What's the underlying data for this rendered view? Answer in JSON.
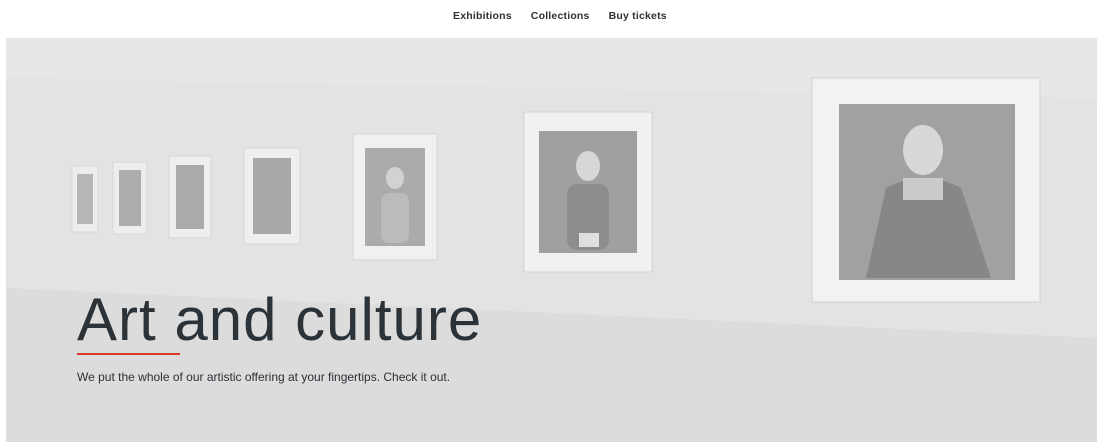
{
  "nav": {
    "items": [
      {
        "label": "Exhibitions"
      },
      {
        "label": "Collections"
      },
      {
        "label": "Buy tickets"
      }
    ]
  },
  "hero": {
    "title": "Art and culture",
    "subtitle": "We put the whole of our artistic offering at your fingertips. Check it out.",
    "accent_color": "#d8392b"
  }
}
